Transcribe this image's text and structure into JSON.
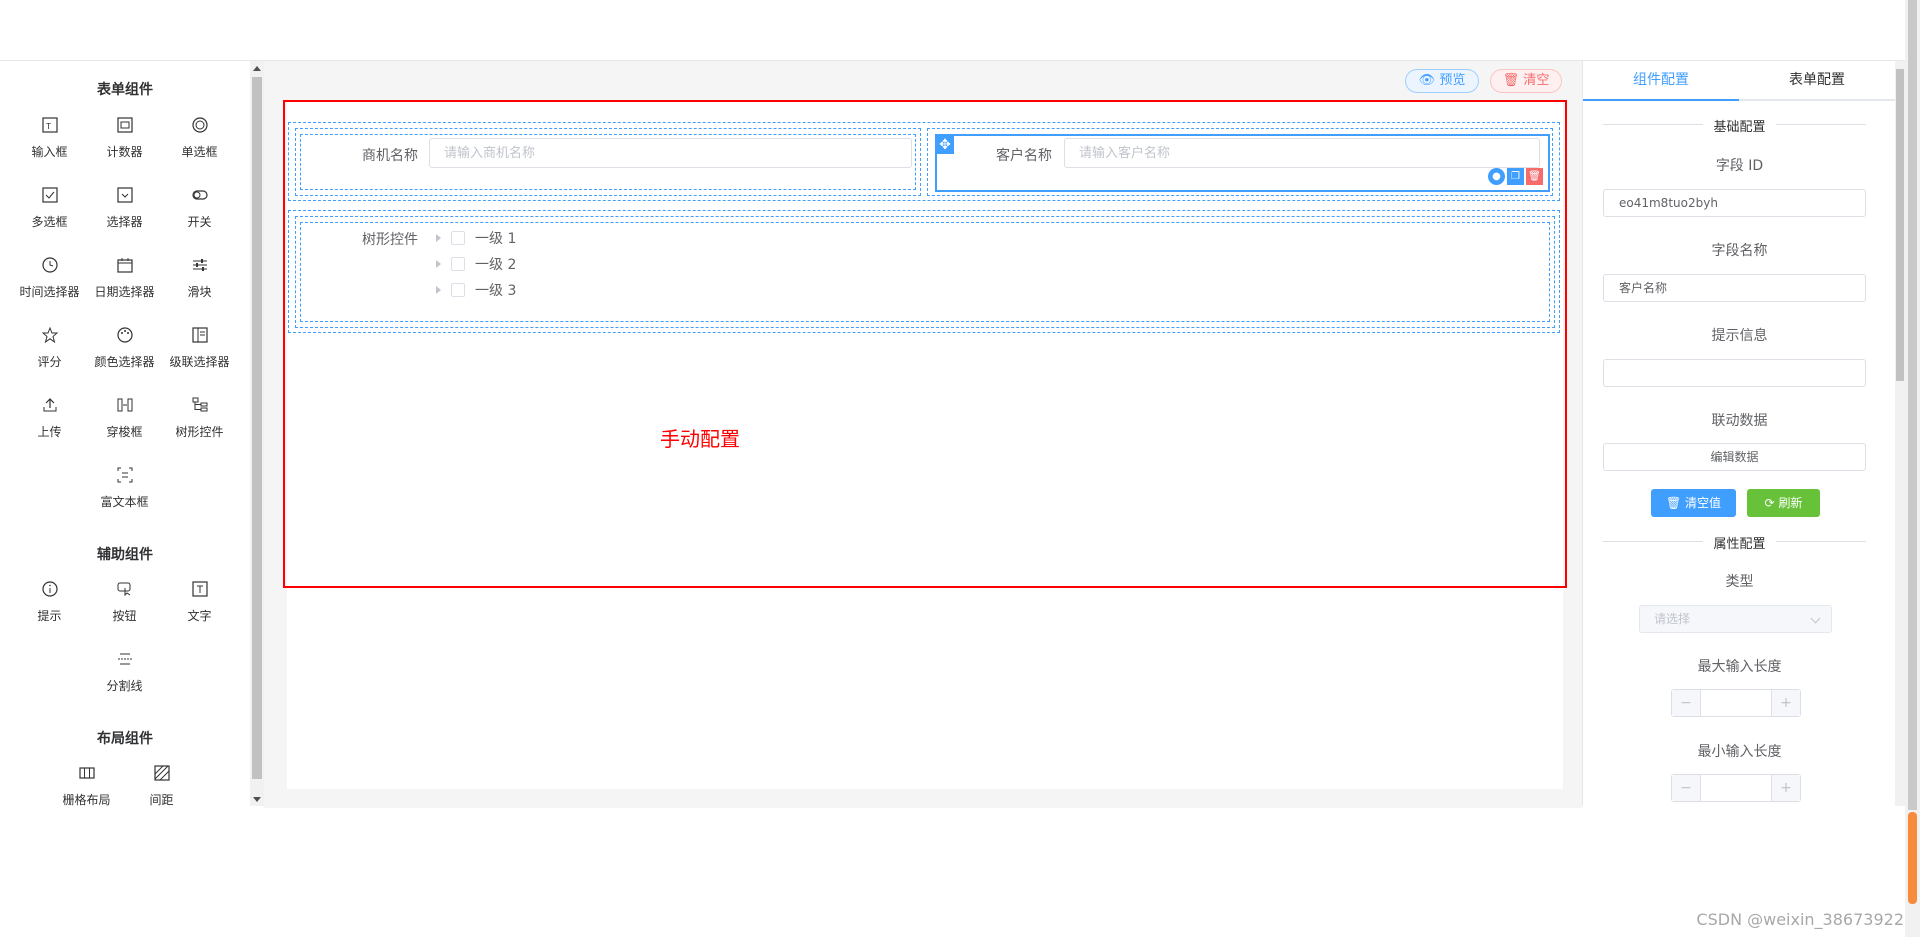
{
  "left": {
    "form_components_title": "表单组件",
    "form_components": [
      {
        "label": "输入框",
        "icon": "input-icon"
      },
      {
        "label": "计数器",
        "icon": "counter-icon"
      },
      {
        "label": "单选框",
        "icon": "radio-icon"
      },
      {
        "label": "多选框",
        "icon": "checkbox-icon"
      },
      {
        "label": "选择器",
        "icon": "select-icon"
      },
      {
        "label": "开关",
        "icon": "switch-icon"
      },
      {
        "label": "时间选择器",
        "icon": "clock-icon"
      },
      {
        "label": "日期选择器",
        "icon": "calendar-icon"
      },
      {
        "label": "滑块",
        "icon": "slider-icon"
      },
      {
        "label": "评分",
        "icon": "star-icon"
      },
      {
        "label": "颜色选择器",
        "icon": "palette-icon"
      },
      {
        "label": "级联选择器",
        "icon": "cascader-icon"
      },
      {
        "label": "上传",
        "icon": "upload-icon"
      },
      {
        "label": "穿梭框",
        "icon": "transfer-icon"
      },
      {
        "label": "树形控件",
        "icon": "tree-icon"
      },
      {
        "label": "富文本框",
        "icon": "rich-text-icon"
      }
    ],
    "aux_components_title": "辅助组件",
    "aux_components": [
      {
        "label": "提示",
        "icon": "info-icon"
      },
      {
        "label": "按钮",
        "icon": "button-icon"
      },
      {
        "label": "文字",
        "icon": "text-icon"
      },
      {
        "label": "分割线",
        "icon": "divider-icon"
      }
    ],
    "layout_components_title": "布局组件",
    "layout_components": [
      {
        "label": "栅格布局",
        "icon": "grid-icon"
      },
      {
        "label": "间距",
        "icon": "spacing-icon"
      }
    ]
  },
  "toolbar": {
    "preview_label": "预览",
    "clear_label": "清空"
  },
  "canvas": {
    "field1_label": "商机名称",
    "field1_placeholder": "请输入商机名称",
    "field2_label": "客户名称",
    "field2_placeholder": "请输入客户名称",
    "tree_label": "树形控件",
    "tree_items": [
      "一级 1",
      "一级 2",
      "一级 3"
    ],
    "annotation": "手动配置"
  },
  "right": {
    "tab_component": "组件配置",
    "tab_form": "表单配置",
    "basic_config": "基础配置",
    "field_id_label": "字段 ID",
    "field_id_value": "eo41m8tuo2byh",
    "field_name_label": "字段名称",
    "field_name_value": "客户名称",
    "hint_label": "提示信息",
    "hint_value": "",
    "linkage_label": "联动数据",
    "edit_data_label": "编辑数据",
    "clear_value_button": "清空值",
    "refresh_button": "刷新",
    "attr_config": "属性配置",
    "type_label": "类型",
    "type_placeholder": "请选择",
    "max_len_label": "最大输入长度",
    "min_len_label": "最小输入长度"
  },
  "watermark": "CSDN @weixin_38673922",
  "colors": {
    "accent": "#409eff",
    "danger": "#f56c6c",
    "success": "#67c23a",
    "annotation": "#ff0000"
  }
}
